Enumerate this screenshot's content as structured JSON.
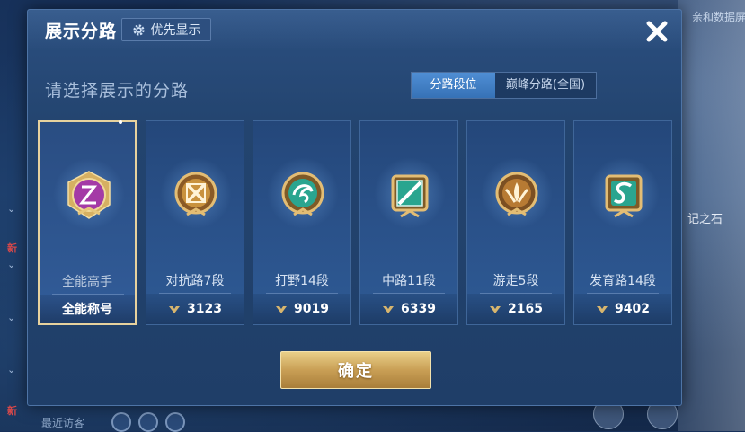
{
  "background": {
    "left_new_badges": [
      "新",
      "新"
    ],
    "recent_visitors_label": "最近访客",
    "right_hint_top": "亲和数据屏",
    "right_hint_mid": "记之石"
  },
  "panel": {
    "title": "展示分路",
    "priority_button_label": "优先显示",
    "subtitle": "请选择展示的分路",
    "tabs": [
      {
        "label": "分路段位",
        "active": true
      },
      {
        "label": "巅峰分路(全国)",
        "active": false
      }
    ],
    "cards": [
      {
        "name": "全能高手",
        "footer": "全能称号",
        "selected": true,
        "has_arrow": false,
        "badge": "allround-badge-icon",
        "accent": "#b23bb5"
      },
      {
        "name": "对抗路7段",
        "footer": "3123",
        "selected": false,
        "has_arrow": true,
        "badge": "clash-lane-badge-icon",
        "accent": "#c9923e"
      },
      {
        "name": "打野14段",
        "footer": "9019",
        "selected": false,
        "has_arrow": true,
        "badge": "jungle-badge-icon",
        "accent": "#2aa58f"
      },
      {
        "name": "中路11段",
        "footer": "6339",
        "selected": false,
        "has_arrow": true,
        "badge": "mid-lane-badge-icon",
        "accent": "#2aa58f"
      },
      {
        "name": "游走5段",
        "footer": "2165",
        "selected": false,
        "has_arrow": true,
        "badge": "roam-badge-icon",
        "accent": "#c9923e"
      },
      {
        "name": "发育路14段",
        "footer": "9402",
        "selected": false,
        "has_arrow": true,
        "badge": "farm-lane-badge-icon",
        "accent": "#2aa58f"
      }
    ],
    "confirm_label": "确定"
  },
  "colors": {
    "gold": "#e7d29e",
    "tab_active": "#3f7fc5",
    "magenta": "#b23bb5",
    "teal": "#2aa58f",
    "bronze": "#c9923e"
  }
}
